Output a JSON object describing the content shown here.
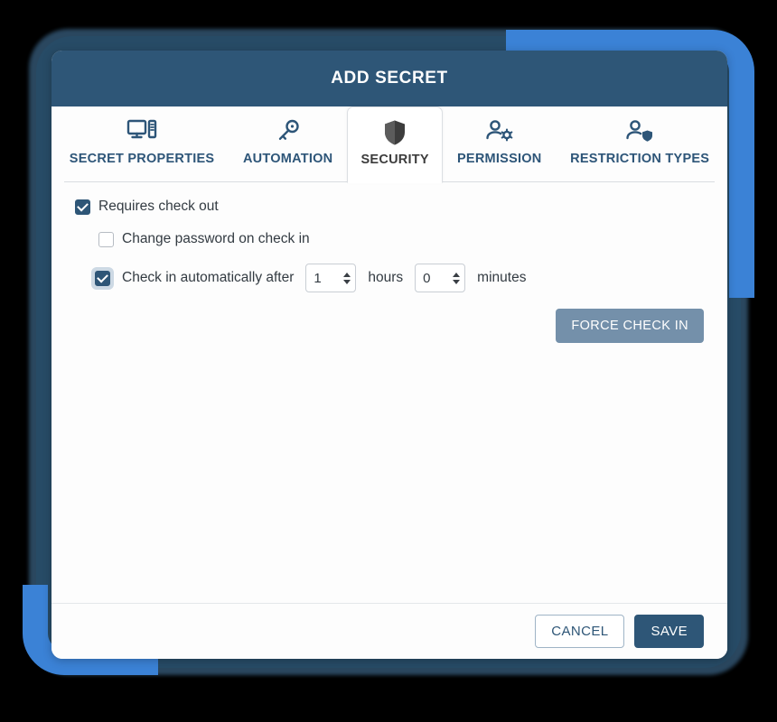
{
  "dialog": {
    "title": "ADD SECRET",
    "tabs": [
      {
        "label": "SECRET PROPERTIES",
        "icon": "monitor-tower-icon",
        "active": false
      },
      {
        "label": "AUTOMATION",
        "icon": "key-icon",
        "active": false
      },
      {
        "label": "SECURITY",
        "icon": "shield-icon",
        "active": true
      },
      {
        "label": "PERMISSION",
        "icon": "person-gear-icon",
        "active": false
      },
      {
        "label": "RESTRICTION TYPES",
        "icon": "person-shield-icon",
        "active": false
      }
    ],
    "body": {
      "requires_check_out": {
        "label": "Requires check out",
        "checked": true
      },
      "change_password": {
        "label": "Change password on check in",
        "checked": false
      },
      "check_in_auto": {
        "label": "Check in automatically after",
        "checked": true,
        "focused": true,
        "hours_value": "1",
        "hours_unit": "hours",
        "minutes_value": "0",
        "minutes_unit": "minutes"
      },
      "force_check_in_label": "FORCE CHECK IN"
    },
    "footer": {
      "cancel_label": "CANCEL",
      "save_label": "SAVE"
    }
  },
  "colors": {
    "header_blue": "#2e5677",
    "accent_blue": "#3b82d6",
    "shadow_navy": "#2c4a63",
    "tab_text": "#2d5578",
    "force_btn": "#7490aa"
  }
}
